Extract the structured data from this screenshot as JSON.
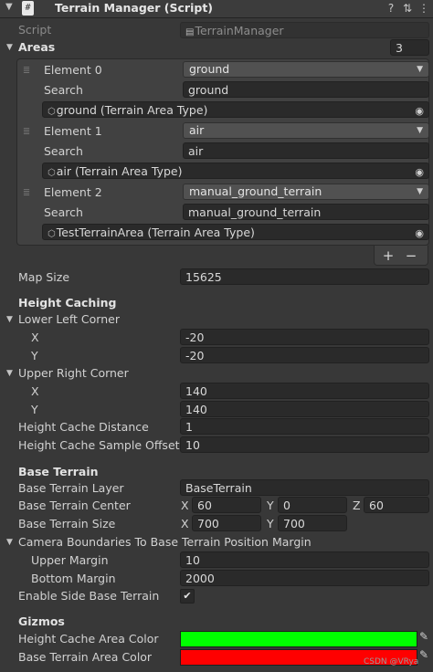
{
  "header": {
    "title": "Terrain Manager (Script)",
    "script_icon": "#",
    "help_icon": "?",
    "preset_icon": "⇅",
    "menu_icon": "⋮"
  },
  "script": {
    "label": "Script",
    "value": "TerrainManager"
  },
  "areas": {
    "label": "Areas",
    "count": "3",
    "elements": [
      {
        "label": "Element 0",
        "dropdown": "ground",
        "search_label": "Search",
        "search_value": "ground",
        "object": "ground (Terrain Area Type)"
      },
      {
        "label": "Element 1",
        "dropdown": "air",
        "search_label": "Search",
        "search_value": "air",
        "object": "air (Terrain Area Type)"
      },
      {
        "label": "Element 2",
        "dropdown": "manual_ground_terrain",
        "search_label": "Search",
        "search_value": "manual_ground_terrain",
        "object": "TestTerrainArea (Terrain Area Type)"
      }
    ],
    "add": "+",
    "remove": "−"
  },
  "map_size": {
    "label": "Map Size",
    "value": "15625"
  },
  "height_caching": {
    "header": "Height Caching",
    "lower_left": {
      "label": "Lower Left Corner",
      "x_label": "X",
      "x": "-20",
      "y_label": "Y",
      "y": "-20"
    },
    "upper_right": {
      "label": "Upper Right Corner",
      "x_label": "X",
      "x": "140",
      "y_label": "Y",
      "y": "140"
    },
    "cache_distance": {
      "label": "Height Cache Distance",
      "value": "1"
    },
    "sample_offset": {
      "label": "Height Cache Sample Offset",
      "value": "10"
    }
  },
  "base_terrain": {
    "header": "Base Terrain",
    "layer": {
      "label": "Base Terrain Layer",
      "value": "BaseTerrain"
    },
    "center": {
      "label": "Base Terrain Center",
      "x_label": "X",
      "x": "60",
      "y_label": "Y",
      "y": "0",
      "z_label": "Z",
      "z": "60"
    },
    "size": {
      "label": "Base Terrain Size",
      "x_label": "X",
      "x": "700",
      "y_label": "Y",
      "y": "700"
    },
    "camera_boundaries": {
      "label": "Camera Boundaries To Base Terrain Position Margin",
      "upper_label": "Upper Margin",
      "upper": "10",
      "bottom_label": "Bottom Margin",
      "bottom": "2000"
    },
    "side_terrain": {
      "label": "Enable Side Base Terrain",
      "checked": true,
      "check_glyph": "✔"
    }
  },
  "gizmos": {
    "header": "Gizmos",
    "height_cache_color": {
      "label": "Height Cache Area Color",
      "color": "#00ff00"
    },
    "base_terrain_color": {
      "label": "Base Terrain Area Color",
      "color": "#ff0000"
    },
    "eyedropper_icon": "✎"
  },
  "watermark": "CSDN @VRya"
}
